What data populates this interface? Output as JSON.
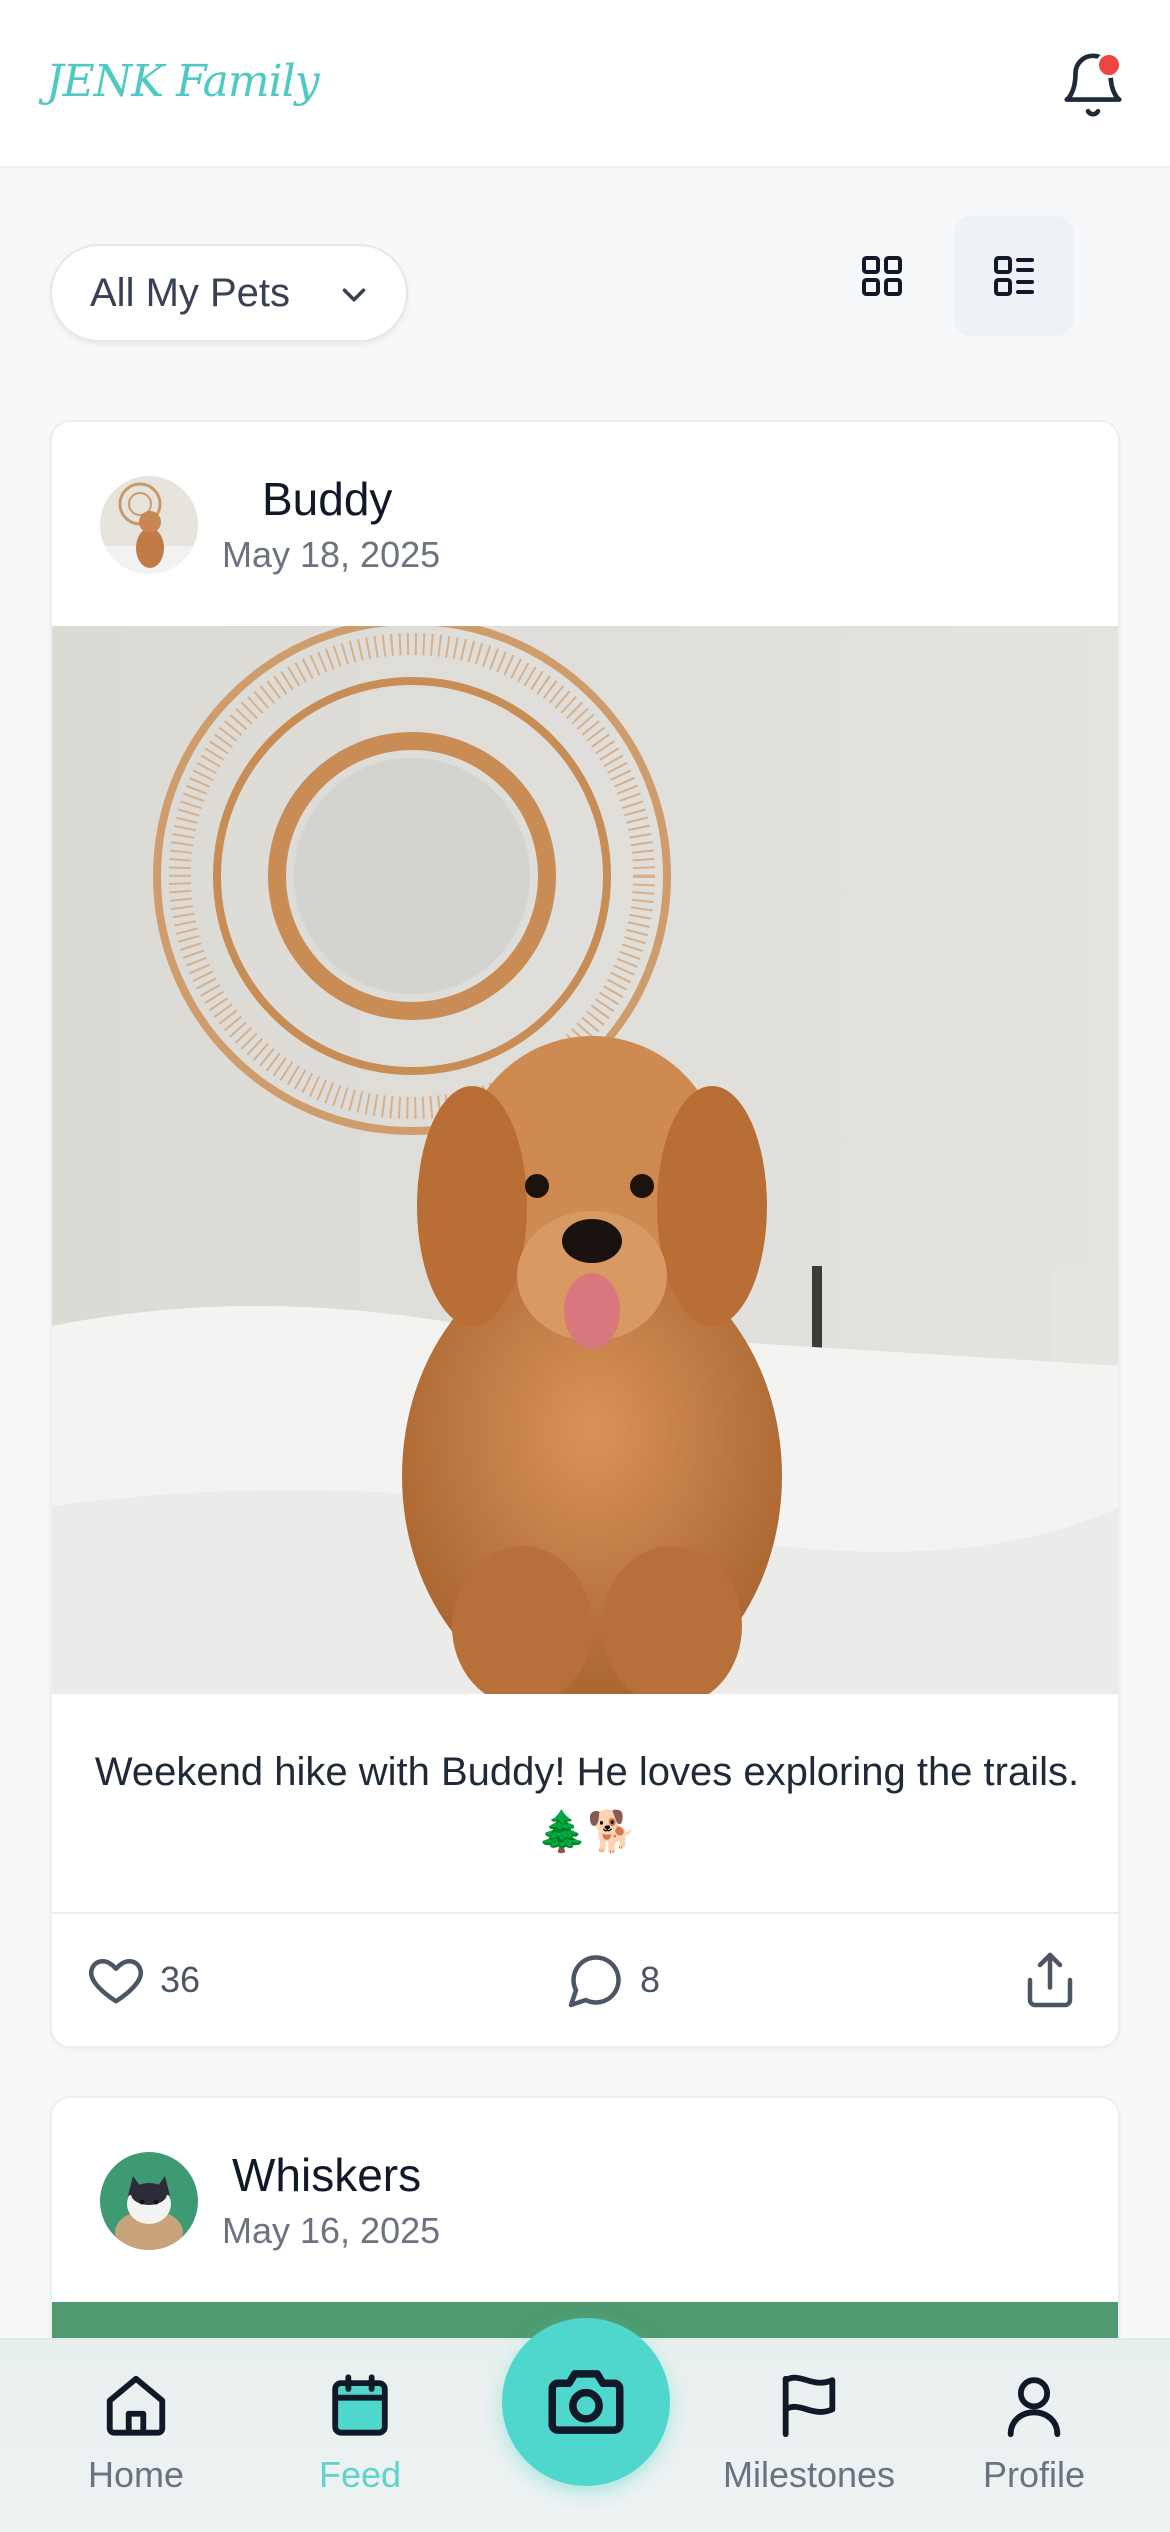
{
  "app": {
    "brand": "JENK Family"
  },
  "filter": {
    "label": "All My Pets"
  },
  "posts": [
    {
      "pet": "Buddy",
      "date": "May 18, 2025",
      "caption": "Weekend hike with Buddy! He loves exploring the trails. 🌲🐕",
      "likes": "36",
      "comments": "8"
    },
    {
      "pet": "Whiskers",
      "date": "May 16, 2025"
    }
  ],
  "nav": {
    "items": [
      {
        "label": "Home"
      },
      {
        "label": "Feed"
      },
      {
        "label": "Milestones"
      },
      {
        "label": "Profile"
      }
    ],
    "active": "Feed"
  },
  "colors": {
    "accent": "#4fd6cd",
    "brand": "#4fc9c1",
    "notification": "#ef4444"
  },
  "icons": [
    "bell-icon",
    "chevron-down-icon",
    "grid-view-icon",
    "list-view-icon",
    "heart-icon",
    "comment-icon",
    "share-icon",
    "home-icon",
    "calendar-icon",
    "camera-icon",
    "flag-icon",
    "user-icon"
  ]
}
